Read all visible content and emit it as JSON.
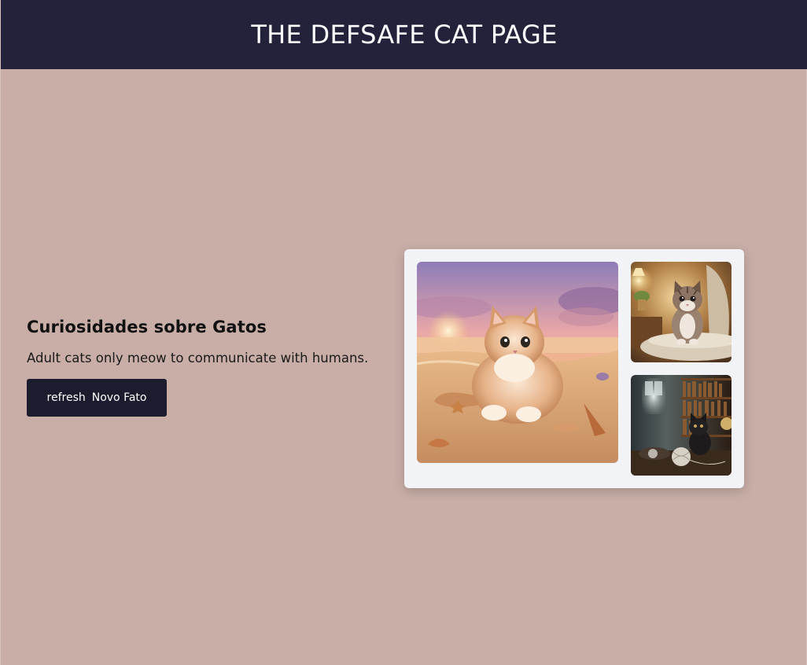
{
  "header": {
    "title": "THE DEFSAFE CAT PAGE"
  },
  "fact": {
    "heading": "Curiosidades sobre Gatos",
    "text": "Adult cats only meow to communicate with humans.",
    "button": {
      "icon_text": "refresh",
      "label": "Novo Fato"
    }
  },
  "gallery": {
    "images": [
      {
        "subject": "fluffy kitten lying on a beach at sunset with seashells"
      },
      {
        "subject": "tabby kitten sitting on a cozy armchair"
      },
      {
        "subject": "dark kitten with yarn ball in a library"
      }
    ]
  },
  "colors": {
    "header_bg": "#22223b",
    "page_bg": "#c8aea7",
    "button_bg": "#1c1c2e",
    "card_bg": "#f2f3f6"
  }
}
